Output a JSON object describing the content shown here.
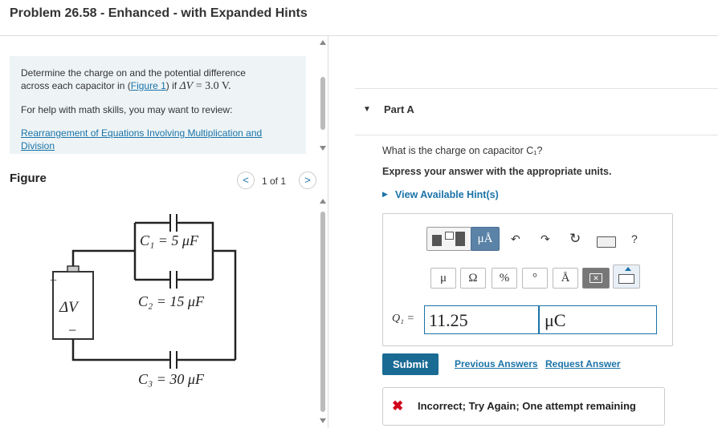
{
  "header": {
    "title": "Problem 26.58 - Enhanced - with Expanded Hints"
  },
  "problem": {
    "line1": "Determine the charge on and the potential difference",
    "line2_prefix": "across each capacitor in (",
    "figure_link": "Figure 1",
    "line2_suffix": ") if ",
    "delta_v": "ΔV",
    "equals_value": " = 3.0 V.",
    "help_text": "For help with math skills, you may want to review:",
    "review_link_1": "Rearrangement of Equations Involving Multiplication and",
    "review_link_2": "Division"
  },
  "figure": {
    "title": "Figure",
    "pager": "1 of 1",
    "prev": "<",
    "next": ">",
    "c1_label": "C₁ = 5 μF",
    "c2_label": "C₂ = 15 μF",
    "c3_label": "C₃ = 30 μF",
    "battery_plus": "+",
    "battery_label": "ΔV",
    "battery_minus": "−"
  },
  "partA": {
    "title": "Part A",
    "question": "What is the charge on capacitor C₁?",
    "instruction": "Express your answer with the appropriate units.",
    "hints_link": "View Available Hint(s)",
    "toolbar": {
      "units_btn": "μÅ",
      "help": "?",
      "mu": "μ",
      "omega": "Ω",
      "percent": "%",
      "degree": "°",
      "angstrom": "Å"
    },
    "answer_label": "Q₁ =",
    "answer_value": "11.25",
    "answer_unit": "μC",
    "submit": "Submit",
    "previous_answers": "Previous Answers",
    "request_answer": "Request Answer",
    "feedback_icon": "✖",
    "feedback_text": "Incorrect; Try Again; One attempt remaining"
  },
  "colors": {
    "accent": "#1a73a8",
    "submit_bg": "#1a6b94",
    "error": "#d0021b",
    "problem_bg": "#eef4f6"
  }
}
